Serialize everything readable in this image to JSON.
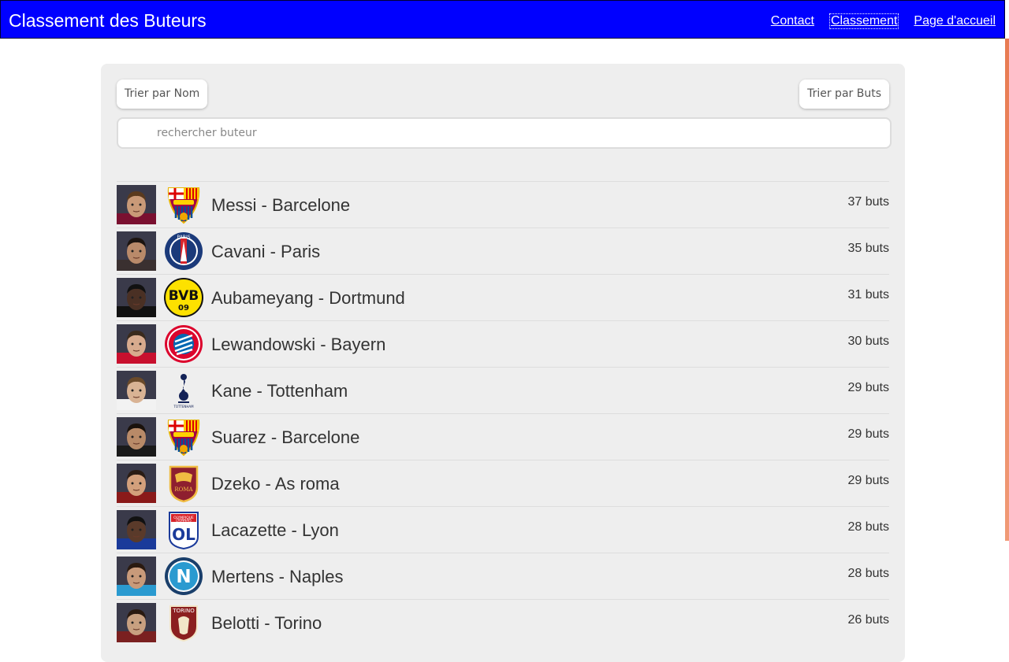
{
  "header": {
    "title": "Classement des Buteurs",
    "links": [
      "Contact",
      "Classement",
      "Page d'accueil"
    ],
    "active_link": "Classement",
    "background_color": "#0000ff"
  },
  "controls": {
    "sort_by_name": "Trier par Nom",
    "sort_by_goals": "Trier par Buts",
    "search_placeholder": "rechercher buteur",
    "search_value": ""
  },
  "scorers": [
    {
      "name": "Messi - Barcelone",
      "goals": "37 buts",
      "club_icon": "barcelona-crest-icon",
      "skin": "#c99a78",
      "shirt": "#7a1030",
      "hair": "#5a3a1e"
    },
    {
      "name": "Cavani - Paris",
      "goals": "35 buts",
      "club_icon": "psg-crest-icon",
      "skin": "#b98a6a",
      "shirt": "#3a3030",
      "hair": "#1c1410"
    },
    {
      "name": "Aubameyang - Dortmund",
      "goals": "31 buts",
      "club_icon": "dortmund-crest-icon",
      "skin": "#4a3024",
      "shirt": "#111111",
      "hair": "#111111"
    },
    {
      "name": "Lewandowski - Bayern",
      "goals": "30 buts",
      "club_icon": "bayern-crest-icon",
      "skin": "#d8ab8e",
      "shirt": "#c8102e",
      "hair": "#3a2a1c"
    },
    {
      "name": "Kane - Tottenham",
      "goals": "29 buts",
      "club_icon": "tottenham-crest-icon",
      "skin": "#d9b394",
      "shirt": "#f2f2f2",
      "hair": "#6a4a2a"
    },
    {
      "name": "Suarez - Barcelone",
      "goals": "29 buts",
      "club_icon": "barcelona-crest-icon",
      "skin": "#b88a68",
      "shirt": "#1a1a1a",
      "hair": "#1a120c"
    },
    {
      "name": "Dzeko - As roma",
      "goals": "29 buts",
      "club_icon": "roma-crest-icon",
      "skin": "#d3a07c",
      "shirt": "#8a1a1a",
      "hair": "#2a1c14"
    },
    {
      "name": "Lacazette - Lyon",
      "goals": "28 buts",
      "club_icon": "lyon-crest-icon",
      "skin": "#5a3a2a",
      "shirt": "#1a3a9a",
      "hair": "#111111"
    },
    {
      "name": "Mertens - Naples",
      "goals": "28 buts",
      "club_icon": "napoli-crest-icon",
      "skin": "#c89a7a",
      "shirt": "#2a9ad0",
      "hair": "#2a1a10"
    },
    {
      "name": "Belotti - Torino",
      "goals": "26 buts",
      "club_icon": "torino-crest-icon",
      "skin": "#c8a080",
      "shirt": "#7a2020",
      "hair": "#2a1a10"
    }
  ]
}
